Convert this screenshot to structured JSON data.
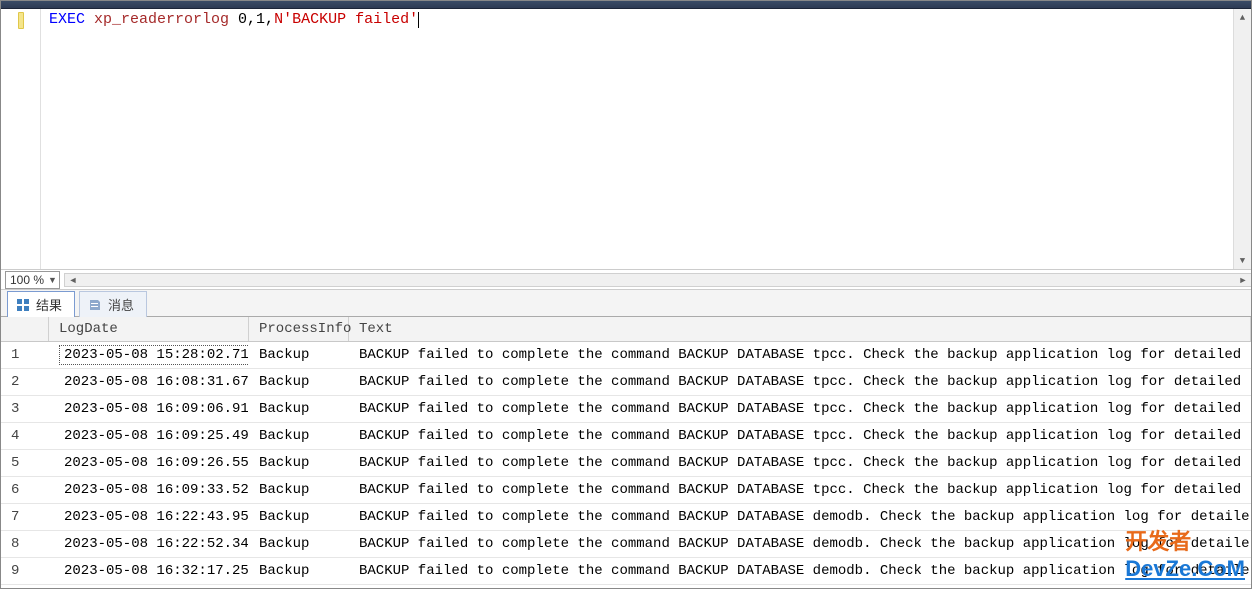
{
  "editor": {
    "sql": {
      "kw_exec": "EXEC",
      "proc": " xp_readerrorlog ",
      "args_plain": "0,1,",
      "str_prefix": "N",
      "str_body": "'BACKUP failed'"
    }
  },
  "zoom": {
    "value": "100 %"
  },
  "tabs": {
    "results": "结果",
    "messages": "消息"
  },
  "grid": {
    "columns": {
      "logdate": "LogDate",
      "processinfo": "ProcessInfo",
      "text": "Text"
    },
    "rows": [
      {
        "n": "1",
        "date": "2023-05-08 15:28:02.710",
        "proc": "Backup",
        "text": "BACKUP failed to complete the command BACKUP DATABASE tpcc. Check the backup application log for detailed messages."
      },
      {
        "n": "2",
        "date": "2023-05-08 16:08:31.670",
        "proc": "Backup",
        "text": "BACKUP failed to complete the command BACKUP DATABASE tpcc. Check the backup application log for detailed messages."
      },
      {
        "n": "3",
        "date": "2023-05-08 16:09:06.910",
        "proc": "Backup",
        "text": "BACKUP failed to complete the command BACKUP DATABASE tpcc. Check the backup application log for detailed messages."
      },
      {
        "n": "4",
        "date": "2023-05-08 16:09:25.490",
        "proc": "Backup",
        "text": "BACKUP failed to complete the command BACKUP DATABASE tpcc. Check the backup application log for detailed messages."
      },
      {
        "n": "5",
        "date": "2023-05-08 16:09:26.550",
        "proc": "Backup",
        "text": "BACKUP failed to complete the command BACKUP DATABASE tpcc. Check the backup application log for detailed messages."
      },
      {
        "n": "6",
        "date": "2023-05-08 16:09:33.520",
        "proc": "Backup",
        "text": "BACKUP failed to complete the command BACKUP DATABASE tpcc. Check the backup application log for detailed messages."
      },
      {
        "n": "7",
        "date": "2023-05-08 16:22:43.950",
        "proc": "Backup",
        "text": "BACKUP failed to complete the command BACKUP DATABASE demodb. Check the backup application log for detailed messages."
      },
      {
        "n": "8",
        "date": "2023-05-08 16:22:52.340",
        "proc": "Backup",
        "text": "BACKUP failed to complete the command BACKUP DATABASE demodb. Check the backup application log for detailed messages."
      },
      {
        "n": "9",
        "date": "2023-05-08 16:32:17.250",
        "proc": "Backup",
        "text": "BACKUP failed to complete the command BACKUP DATABASE demodb. Check the backup application log for detailed messages."
      }
    ],
    "selected_index": 0
  },
  "watermark": {
    "part1": "开发者",
    "part2": "DevZe.CoM"
  }
}
